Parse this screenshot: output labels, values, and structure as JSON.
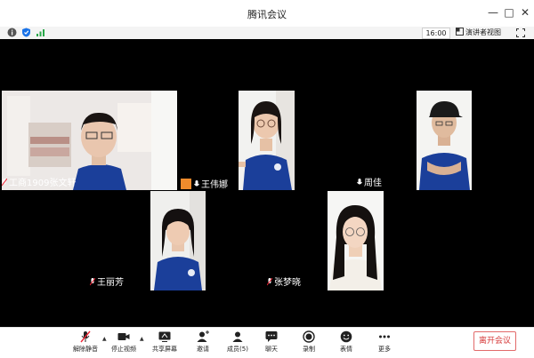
{
  "window": {
    "title": "腾讯会议"
  },
  "infobar": {
    "time": "16:00",
    "speaker_view": "演讲者视图"
  },
  "participants": [
    {
      "name": "工商1909张文轩"
    },
    {
      "name": "王伟娜"
    },
    {
      "name": "周佳"
    },
    {
      "name": "王丽芳"
    },
    {
      "name": "张梦晓"
    }
  ],
  "toolbar": {
    "unmute": "解除静音",
    "stop_video": "停止视频",
    "share_screen": "共享屏幕",
    "invite": "邀请",
    "members": "成员(5)",
    "chat": "聊天",
    "record": "录制",
    "reactions": "表情",
    "more": "更多",
    "leave": "离开会议"
  },
  "colors": {
    "accent_green": "#2aa84a",
    "accent_blue": "#1a73e8",
    "leave_red": "#d63a3a",
    "shirt_blue": "#1b3f9a"
  }
}
